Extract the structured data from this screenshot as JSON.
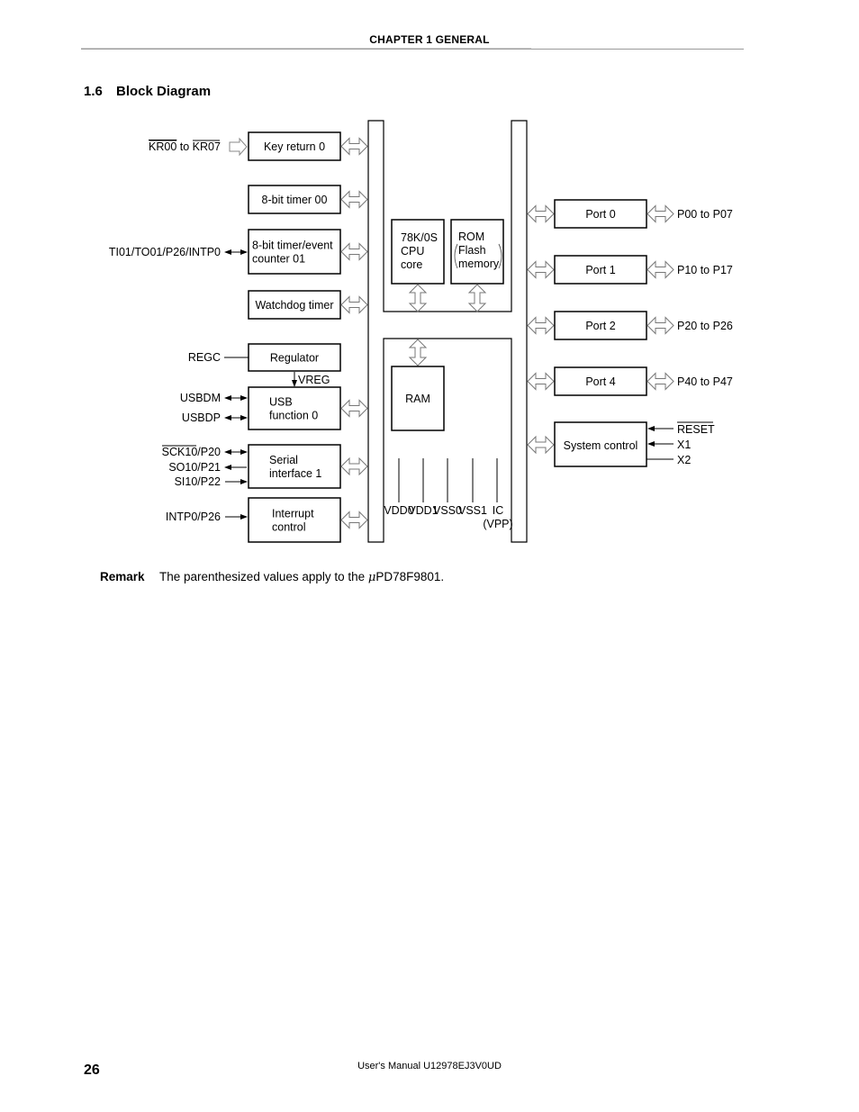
{
  "header": {
    "chapter": "CHAPTER 1   GENERAL"
  },
  "section": {
    "number": "1.6",
    "title": "Block Diagram"
  },
  "diagram": {
    "left_blocks": [
      {
        "id": "key-return",
        "lines": [
          "Key return 0"
        ]
      },
      {
        "id": "timer00",
        "lines": [
          "8-bit timer 00"
        ]
      },
      {
        "id": "timer01",
        "lines": [
          "8-bit timer/event",
          "counter 01"
        ]
      },
      {
        "id": "watchdog",
        "lines": [
          "Watchdog timer"
        ]
      },
      {
        "id": "regulator",
        "lines": [
          "Regulator"
        ]
      },
      {
        "id": "usb",
        "lines": [
          "USB",
          "function 0"
        ]
      },
      {
        "id": "serial",
        "lines": [
          "Serial",
          "interface 1"
        ]
      },
      {
        "id": "interrupt",
        "lines": [
          "Interrupt",
          "control"
        ]
      }
    ],
    "left_signals": {
      "kr_from": "KR00",
      "kr_to_word": " to ",
      "kr_to": "KR07",
      "timer01_pin": "TI01/TO01/P26/INTP0",
      "regc": "REGC",
      "vreg_main": "V",
      "vreg_sub": "REG",
      "usbdm": "USBDM",
      "usbdp": "USBDP",
      "sck_overbar": "SCK10",
      "sck_rest": "/P20",
      "so": "SO10/P21",
      "si": "SI10/P22",
      "intp": "INTP0/P26"
    },
    "core": {
      "cpu": [
        "78K/0S",
        "CPU",
        "core"
      ],
      "rom": [
        "ROM",
        "Flash",
        "memory"
      ],
      "ram": "RAM",
      "power_pins": [
        {
          "main": "V",
          "sub": "DD0"
        },
        {
          "main": "V",
          "sub": "DD1"
        },
        {
          "main": "V",
          "sub": "SS0"
        },
        {
          "main": "V",
          "sub": "SS1"
        }
      ],
      "ic": "IC",
      "vpp_main": "V",
      "vpp_sub": "PP"
    },
    "ports": [
      {
        "label": "Port 0",
        "pins": "P00 to P07"
      },
      {
        "label": "Port 1",
        "pins": "P10 to P17"
      },
      {
        "label": "Port 2",
        "pins": "P20 to P26"
      },
      {
        "label": "Port 4",
        "pins": "P40 to P47"
      }
    ],
    "system_control": {
      "label": "System control",
      "reset": "RESET",
      "x1": "X1",
      "x2": "X2"
    }
  },
  "remark": {
    "label": "Remark",
    "text_before": "The parenthesized values apply to the ",
    "mu": "μ",
    "text_after": "PD78F9801."
  },
  "footer": {
    "page_number": "26",
    "manual": "User's Manual  U12978EJ3V0UD"
  }
}
